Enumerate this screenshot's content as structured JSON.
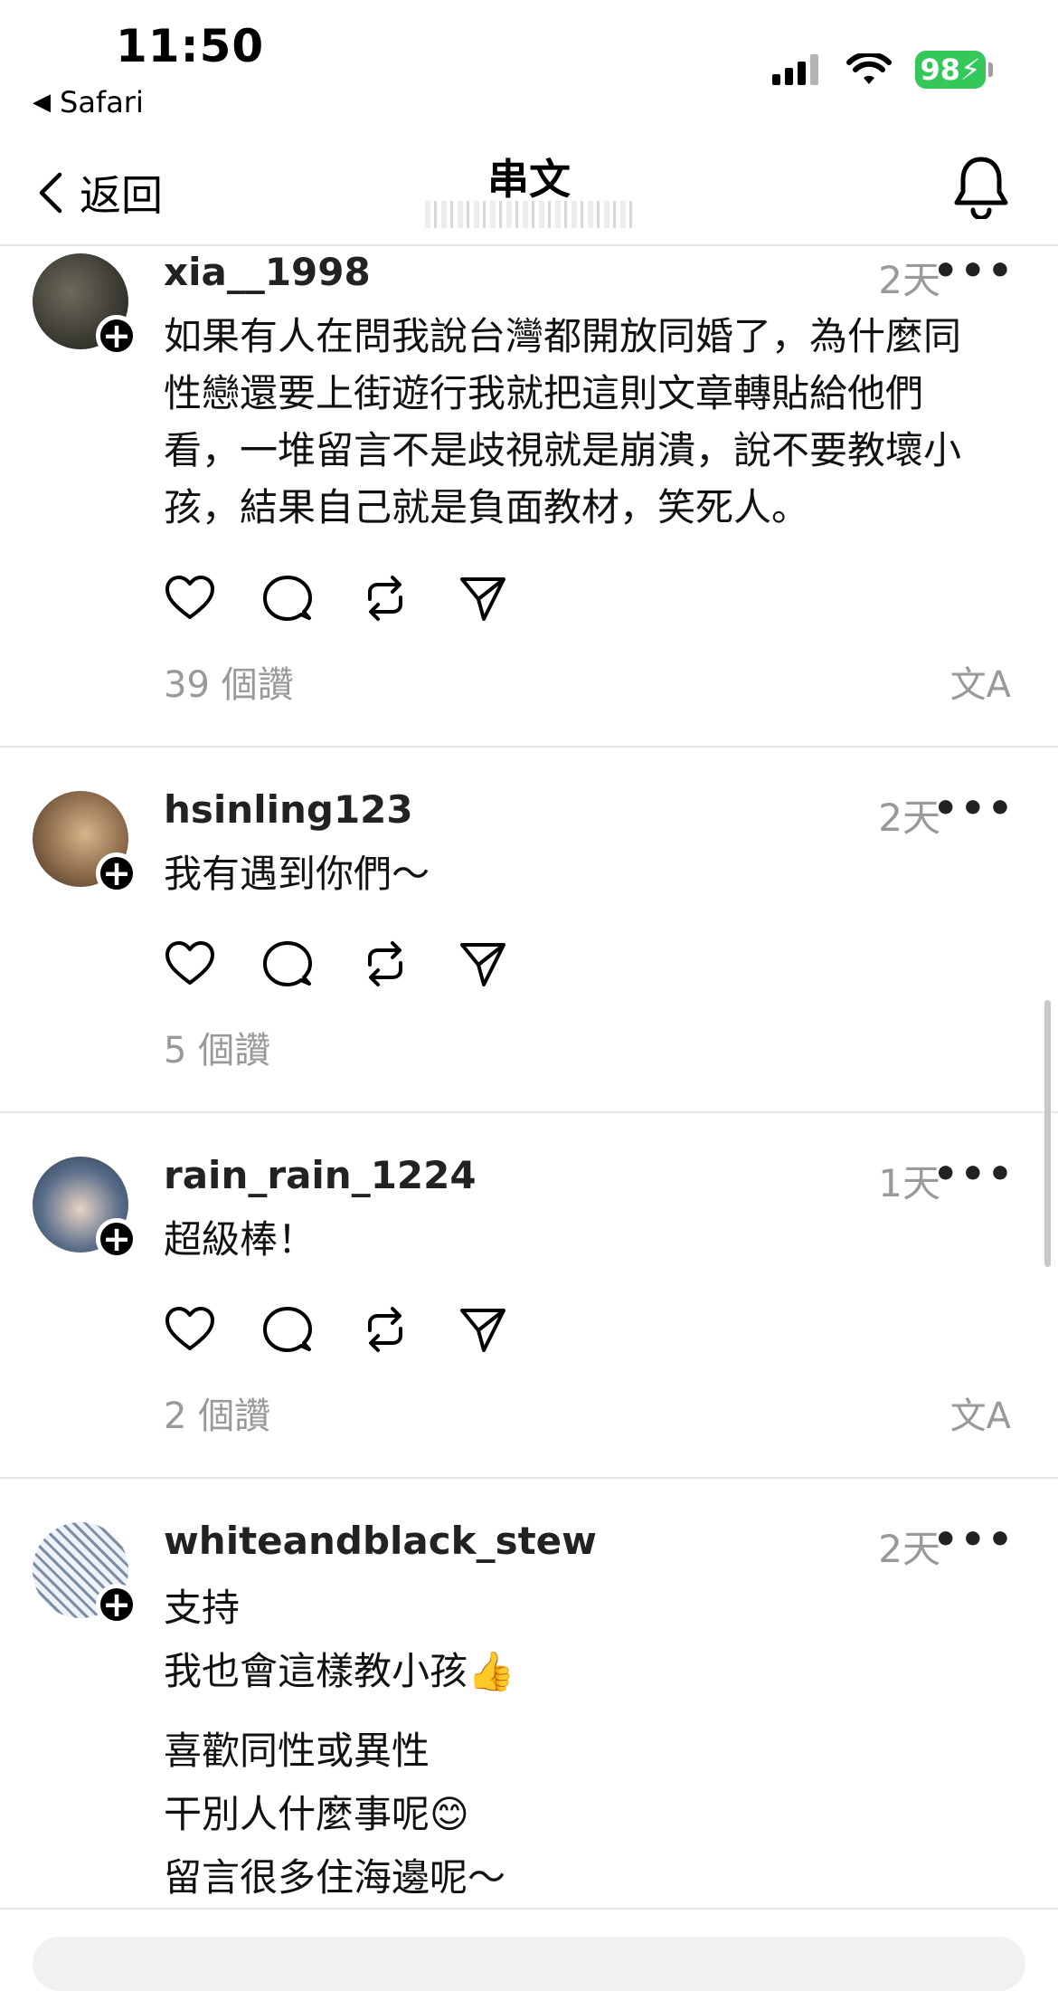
{
  "status": {
    "time": "11:50",
    "back_app": "Safari",
    "battery": "98"
  },
  "nav": {
    "back_label": "返回",
    "title": "串文"
  },
  "posts": [
    {
      "username": "xia__1998",
      "time_ago": "2天",
      "lines": [
        "如果有人在問我說台灣都開放同婚了，為什麼同",
        "性戀還要上街遊行我就把這則文章轉貼給他們",
        "看，一堆留言不是歧視就是崩潰，說不要教壞小",
        "孩，結果自己就是負面教材，笑死人。"
      ],
      "likes": "39 個讚",
      "show_translate": true
    },
    {
      "username": "hsinling123",
      "time_ago": "2天",
      "lines": [
        "我有遇到你們～"
      ],
      "likes": "5 個讚",
      "show_translate": false
    },
    {
      "username": "rain_rain_1224",
      "time_ago": "1天",
      "lines": [
        "超級棒！"
      ],
      "likes": "2 個讚",
      "show_translate": true
    },
    {
      "username": "whiteandblack_stew",
      "time_ago": "2天",
      "lines": [
        "支持",
        "我也會這樣教小孩👍",
        "喜歡同性或異性",
        "干別人什麼事呢😊",
        "留言很多住海邊呢～"
      ]
    }
  ],
  "translate_icon": "文A",
  "more_icon": "•••",
  "icons": [
    "heart-icon",
    "comment-icon",
    "repost-icon",
    "share-icon",
    "bell-icon",
    "signal-icon",
    "wifi-icon"
  ]
}
